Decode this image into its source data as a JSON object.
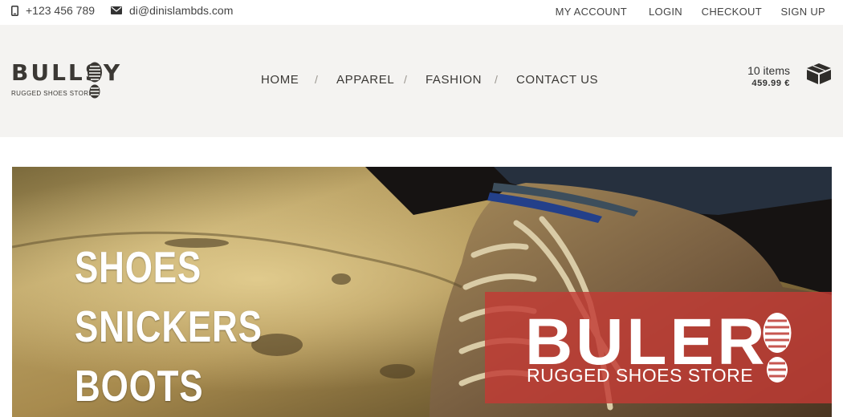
{
  "topbar": {
    "phone": {
      "icon": "phone-icon",
      "text": "+123 456 789"
    },
    "email": {
      "icon": "envelope-icon",
      "text": "di@dinislambds.com"
    },
    "links": [
      "MY ACCOUNT",
      "LOGIN",
      "CHECKOUT",
      "SIGN UP"
    ]
  },
  "header": {
    "logo": {
      "name": "BULLSY",
      "tagline": "RUGGED SHOES STORE",
      "icon": "boot-print-icon"
    },
    "nav": {
      "items": [
        "HOME",
        "APPAREL",
        "FASHION",
        "CONTACT US"
      ],
      "separator": "/"
    },
    "cart": {
      "count": "10 items",
      "total": "459.99 €",
      "icon": "box-icon"
    }
  },
  "hero": {
    "words": [
      "SHOES",
      "SNICKERS",
      "BOOTS"
    ],
    "promo": {
      "name": "BULER",
      "tagline": "RUGGED SHOES STORE",
      "icon": "boot-print-icon",
      "color": "#c23a34"
    }
  },
  "colors": {
    "header_bg": "#f4f3f1",
    "text_dark": "#3a3835",
    "promo_red": "#c23a34"
  }
}
